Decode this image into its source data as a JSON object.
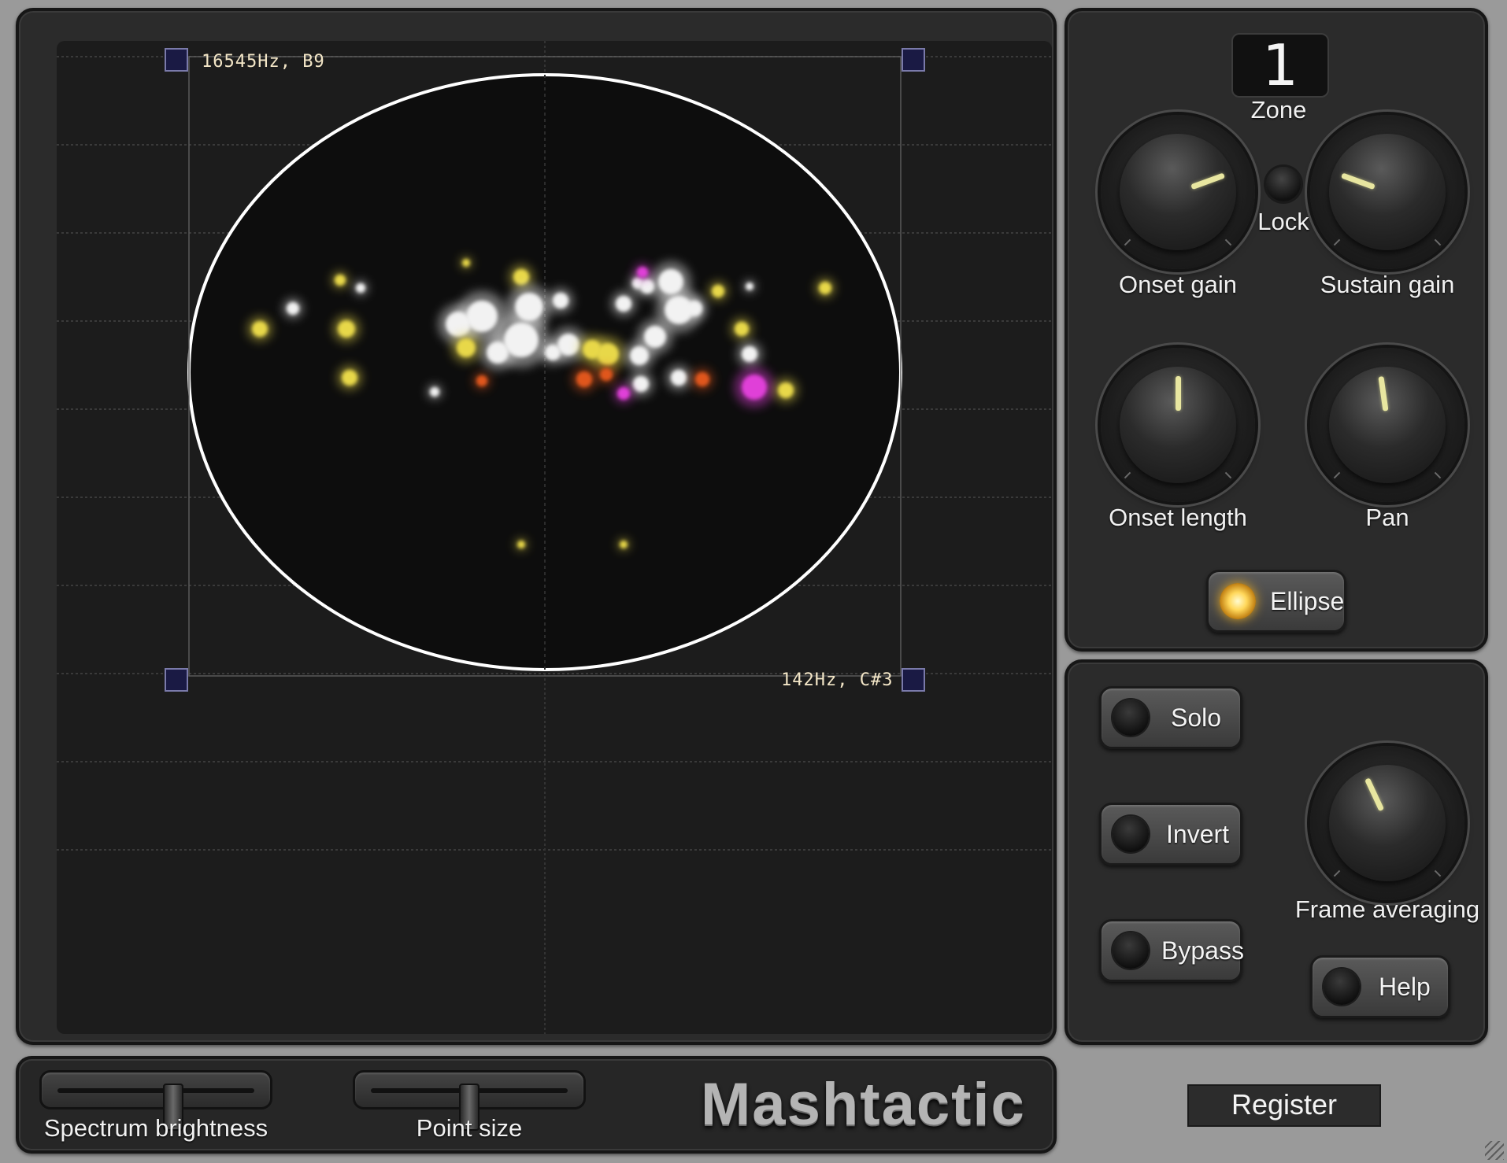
{
  "app": {
    "name": "Mashtactic",
    "register_label": "Register"
  },
  "display": {
    "top_left_label": "16545Hz, B9",
    "bottom_right_label": "142Hz, C#3"
  },
  "zone": {
    "number": "1",
    "label": "Zone",
    "lock_label": "Lock"
  },
  "knobs": [
    {
      "id": "onset_gain",
      "label": "Onset gain",
      "angle_deg": 70
    },
    {
      "id": "sustain_gain",
      "label": "Sustain gain",
      "angle_deg": -70
    },
    {
      "id": "onset_length",
      "label": "Onset length",
      "angle_deg": 0
    },
    {
      "id": "pan",
      "label": "Pan",
      "angle_deg": -8
    },
    {
      "id": "frame_averaging",
      "label": "Frame averaging",
      "angle_deg": -25
    }
  ],
  "buttons": {
    "ellipse": {
      "label": "Ellipse",
      "on": true
    },
    "solo": {
      "label": "Solo",
      "on": false
    },
    "invert": {
      "label": "Invert",
      "on": false
    },
    "bypass": {
      "label": "Bypass",
      "on": false
    },
    "help": {
      "label": "Help",
      "on": false
    }
  },
  "sliders": {
    "spectrum_brightness": {
      "label": "Spectrum brightness",
      "value": 0.58
    },
    "point_size": {
      "label": "Point size",
      "value": 0.49
    }
  },
  "colors": {
    "ellipse_stroke": "#ffffff",
    "spot_white": "#f2f2f2",
    "spot_yellow": "#e8d84a",
    "spot_orange": "#e0561c",
    "spot_magenta": "#e040d8",
    "knob_pointer": "#e8e6a0"
  }
}
